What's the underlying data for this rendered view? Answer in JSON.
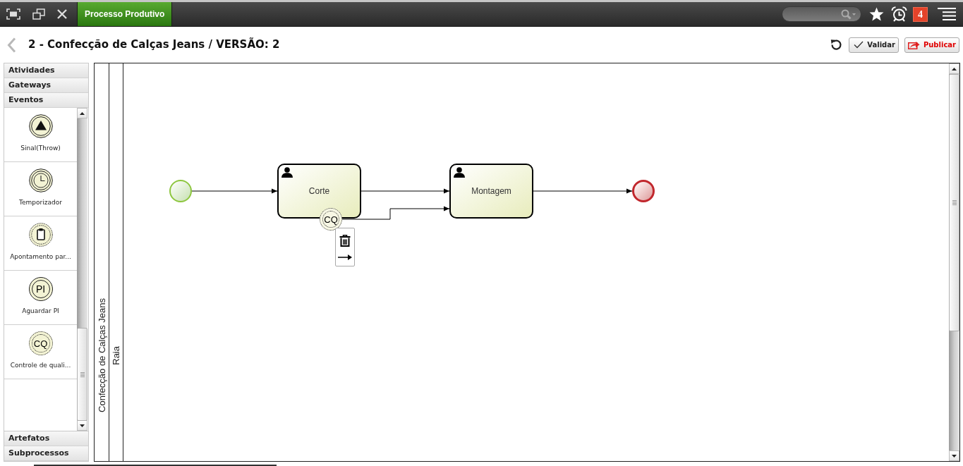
{
  "top_bar": {
    "tabs": [
      {
        "label": "Processo Produtivo",
        "selected": true
      }
    ],
    "notification_count": "4"
  },
  "header": {
    "title": "2 - Confecção de Calças Jeans / VERSÃO: 2",
    "buttons": [
      {
        "kind": "validate",
        "label": "Validar"
      },
      {
        "kind": "publish",
        "label": "Publicar"
      }
    ]
  },
  "palette": {
    "sections": [
      {
        "label": "Atividades"
      },
      {
        "label": "Gateways"
      },
      {
        "label": "Eventos",
        "items": [
          {
            "kind": "signal",
            "label": "Sinal(Throw)"
          },
          {
            "kind": "timer",
            "label": "Temporizador"
          },
          {
            "kind": "clipboard",
            "label": "Apontamento par..."
          },
          {
            "kind": "intermediate",
            "symbol": "PI",
            "label": "Aguardar PI"
          },
          {
            "kind": "boundary",
            "symbol": "CQ",
            "label": "Controle de quali..."
          }
        ]
      },
      {
        "label": "Artefatos"
      },
      {
        "label": "Subprocessos"
      }
    ]
  },
  "pool": {
    "label": "Confecção de Calças Jeans",
    "lanes": [
      {
        "label": "Raia"
      }
    ]
  },
  "diagram": {
    "nodes": [
      {
        "kind": "start",
        "selected": false
      },
      {
        "kind": "user_task",
        "label": "Corte",
        "selected": false
      },
      {
        "kind": "user_task",
        "label": "Montagem",
        "selected": false
      },
      {
        "kind": "end",
        "selected": false
      },
      {
        "kind": "boundary",
        "symbol": "CQ",
        "selected": true
      }
    ]
  }
}
